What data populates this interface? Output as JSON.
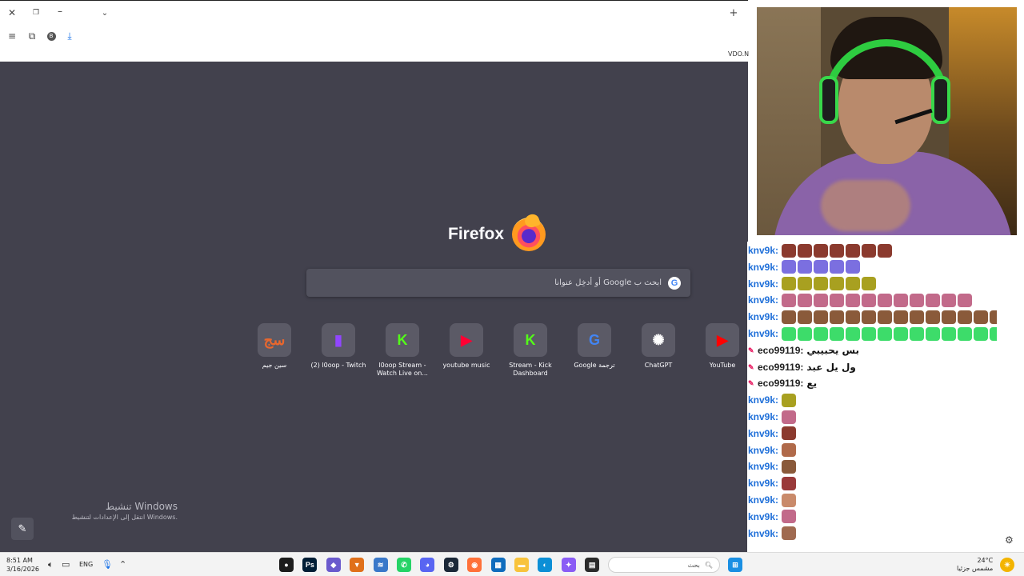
{
  "browser": {
    "site_label": "VDO.N",
    "toolbar_icons": [
      "close-icon",
      "restore-icon",
      "minimize-icon",
      "chevron-down-icon",
      "new-tab-icon",
      "menu-icon",
      "extensions-icon",
      "account-icon",
      "download-icon"
    ]
  },
  "newtab": {
    "brand": "Firefox",
    "search_placeholder": "ابحث ب Google أو أدخِل عنوانا",
    "tiles": [
      {
        "label": "سين جيم",
        "icon": "seen-jeem-icon",
        "color": "#e8672e"
      },
      {
        "label": "(2) l0oop - Twitch",
        "icon": "twitch-icon",
        "color": "#9146ff"
      },
      {
        "label": "l0oop Stream - Watch Live on...",
        "icon": "kick-icon",
        "color": "#53fc18"
      },
      {
        "label": "youtube music",
        "icon": "youtube-music-icon",
        "color": "#ff0033"
      },
      {
        "label": "Stream - Kick Dashboard",
        "icon": "kick-icon",
        "color": "#53fc18"
      },
      {
        "label": "Google ترجمة",
        "icon": "google-translate-icon",
        "color": "#4285f4"
      },
      {
        "label": "ChatGPT",
        "icon": "chatgpt-icon",
        "color": "#ffffff"
      },
      {
        "label": "YouTube",
        "icon": "youtube-icon",
        "color": "#ff0000"
      }
    ],
    "activation": {
      "title": "تنشيط Windows",
      "subtitle": "انتقل إلى الإعدادات لتنشيط Windows."
    }
  },
  "chat": {
    "messages": [
      {
        "user": "knv9k",
        "emotes": 7,
        "emote_color": "#8b3a2e"
      },
      {
        "user": "knv9k",
        "emotes": 5,
        "emote_color": "#7b6fe0"
      },
      {
        "user": "knv9k",
        "emotes": 6,
        "emote_color": "#a8a020"
      },
      {
        "user": "knv9k",
        "emotes": 12,
        "emote_color": "#c26a8a"
      },
      {
        "user": "knv9k",
        "emotes": 14,
        "emote_color": "#8a5a3a"
      },
      {
        "user": "knv9k",
        "emotes": 14,
        "emote_color": "#3ddc6a"
      },
      {
        "user": "eco99119",
        "text": "بس يحبيبي"
      },
      {
        "user": "eco99119",
        "text": "ول يل عبد"
      },
      {
        "user": "eco99119",
        "text": "يع"
      },
      {
        "user": "knv9k",
        "emotes": 1,
        "emote_color": "#a8a020"
      },
      {
        "user": "knv9k",
        "emotes": 1,
        "emote_color": "#c26a8a"
      },
      {
        "user": "knv9k",
        "emotes": 1,
        "emote_color": "#8b3a2e"
      },
      {
        "user": "knv9k",
        "emotes": 1,
        "emote_color": "#b06a4a"
      },
      {
        "user": "knv9k",
        "emotes": 1,
        "emote_color": "#8a5a3a"
      },
      {
        "user": "knv9k",
        "emotes": 1,
        "emote_color": "#9a3a3a"
      },
      {
        "user": "knv9k",
        "emotes": 1,
        "emote_color": "#c98a6a"
      },
      {
        "user": "knv9k",
        "emotes": 1,
        "emote_color": "#c26a8a"
      },
      {
        "user": "knv9k",
        "emotes": 1,
        "emote_color": "#a06a50"
      }
    ]
  },
  "taskbar": {
    "time": "8:51 AM",
    "date": "3/16/2026",
    "lang": "ENG",
    "search_placeholder": "بحث",
    "weather_temp": "24°C",
    "weather_desc": "مشمس جزئيا",
    "apps": [
      {
        "icon": "obs-icon",
        "color": "#1c1c1c"
      },
      {
        "icon": "photoshop-icon",
        "color": "#001e36"
      },
      {
        "icon": "game-icon",
        "color": "#6a5acd"
      },
      {
        "icon": "brave-icon",
        "color": "#e0701a"
      },
      {
        "icon": "stack-icon",
        "color": "#3a78c9"
      },
      {
        "icon": "whatsapp-icon",
        "color": "#25d366"
      },
      {
        "icon": "discord-icon",
        "color": "#5865f2"
      },
      {
        "icon": "steam-icon",
        "color": "#1b2838"
      },
      {
        "icon": "firefox-icon",
        "color": "#ff7139"
      },
      {
        "icon": "store-icon",
        "color": "#0f6cbd"
      },
      {
        "icon": "folder-icon",
        "color": "#f8c33c"
      },
      {
        "icon": "edge-icon",
        "color": "#0c8fd6"
      },
      {
        "icon": "copilot-icon",
        "color": "#8a5cf5"
      },
      {
        "icon": "app-icon",
        "color": "#2b2b2b"
      }
    ]
  }
}
